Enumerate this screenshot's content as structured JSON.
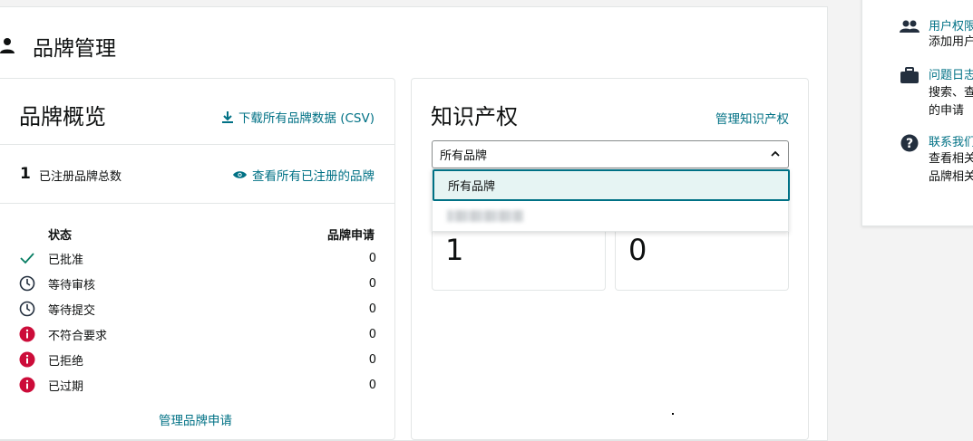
{
  "page": {
    "title": "品牌管理"
  },
  "overview": {
    "title": "品牌概览",
    "download_link": "下载所有品牌数据 (CSV)",
    "total_count": "1",
    "total_label": "已注册品牌总数",
    "view_all_link": "查看所有已注册的品牌",
    "col_status": "状态",
    "col_applications": "品牌申请",
    "rows": [
      {
        "icon": "check-icon",
        "label": "已批准",
        "count": "0"
      },
      {
        "icon": "clock-icon",
        "label": "等待审核",
        "count": "0"
      },
      {
        "icon": "clock-icon",
        "label": "等待提交",
        "count": "0"
      },
      {
        "icon": "info-alert-icon",
        "label": "不符合要求",
        "count": "0"
      },
      {
        "icon": "info-alert-icon",
        "label": "已拒绝",
        "count": "0"
      },
      {
        "icon": "info-alert-icon",
        "label": "已过期",
        "count": "0"
      }
    ],
    "manage_link": "管理品牌申请"
  },
  "ip": {
    "title": "知识产权",
    "manage_link": "管理知识产权",
    "select_value": "所有品牌",
    "options": [
      "所有品牌"
    ],
    "stat1": "1",
    "stat2": "0"
  },
  "help": {
    "items": [
      {
        "icon": "group-icon",
        "title": "用户权限",
        "desc": [
          "添加用户"
        ]
      },
      {
        "icon": "briefcase-icon",
        "title": "问题日志",
        "desc": [
          "搜索、查",
          "的申请"
        ]
      },
      {
        "icon": "help-icon",
        "title": "联系我们",
        "desc": [
          "查看相关",
          "品牌相关"
        ]
      }
    ]
  },
  "colors": {
    "accent": "#007185",
    "alert": "#cc0c39",
    "check": "#067d62"
  }
}
